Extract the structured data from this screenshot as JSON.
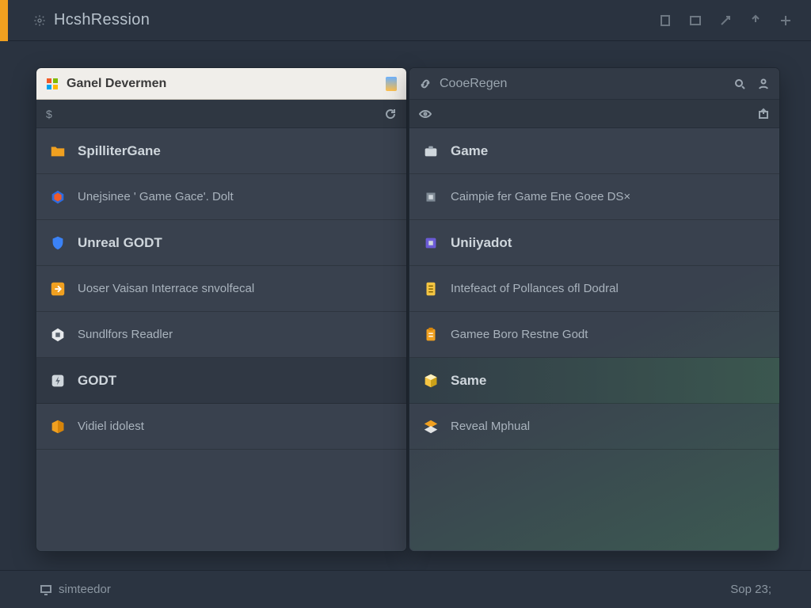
{
  "title": "HcshRession",
  "left_panel": {
    "title": "Ganel Devermen",
    "filter_left": "$",
    "items": [
      {
        "label": "SpilliterGane",
        "icon": "folder-orange",
        "variant": "head"
      },
      {
        "label": "Unejsinee ' Game Gace'. Dolt",
        "icon": "hex-multi",
        "variant": "sub"
      },
      {
        "label": "Unreal GODT",
        "icon": "shield-blue",
        "variant": "head"
      },
      {
        "label": "Uoser Vaisan Interrace snvolfecal",
        "icon": "arrow-orange",
        "variant": "sub"
      },
      {
        "label": "Sundlfors Readler",
        "icon": "hex-white",
        "variant": "sub"
      },
      {
        "label": "GODT",
        "icon": "bolt-grey",
        "variant": "head",
        "selected": true
      },
      {
        "label": "Vidiel idolest",
        "icon": "cube-orange",
        "variant": "sub"
      }
    ]
  },
  "right_panel": {
    "title": "CooeRegen",
    "items": [
      {
        "label": "Game",
        "icon": "case-grey",
        "variant": "head"
      },
      {
        "label": "Caimpie fer Game Ene Goee DS×",
        "icon": "chip-grey",
        "variant": "sub"
      },
      {
        "label": "Uniiyadot",
        "icon": "square-purple",
        "variant": "head"
      },
      {
        "label": "Intefeact of Pollances ofl Dodral",
        "icon": "doc-yellow",
        "variant": "sub"
      },
      {
        "label": "Gamee Boro Restne Godt",
        "icon": "clip-orange",
        "variant": "sub"
      },
      {
        "label": "Same",
        "icon": "cube-yellow",
        "variant": "head",
        "selected": true
      },
      {
        "label": "Reveal Mphual",
        "icon": "layers-orange",
        "variant": "sub"
      }
    ]
  },
  "status_left": "simteedor",
  "status_right": "Sop 23;"
}
